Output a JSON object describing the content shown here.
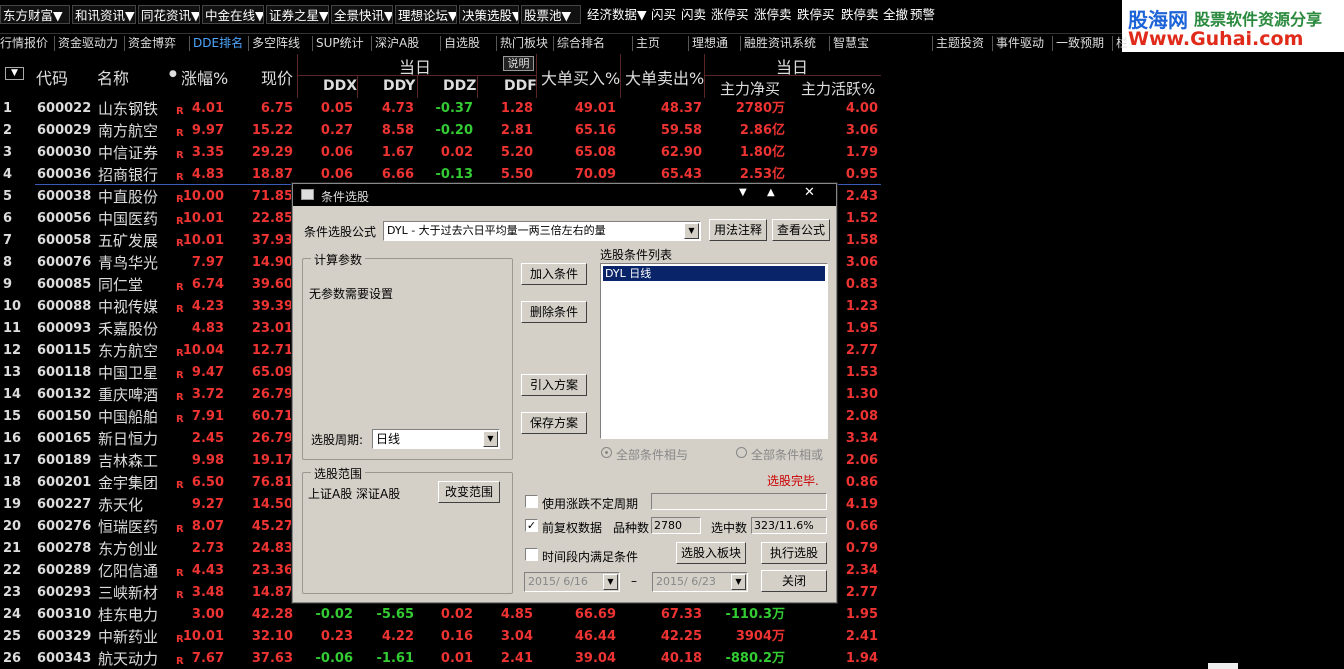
{
  "menu": [
    "东方财富▼",
    "和讯资讯▼",
    "同花资讯▼",
    "中金在线▼",
    "证券之星▼",
    "全景快讯▼",
    "理想论坛▼",
    "决策选股▼",
    "股票池▼"
  ],
  "menu_right": [
    "经济数据▼",
    "闪买",
    "闪卖",
    "涨停买",
    "涨停卖",
    "跌停买",
    "跌停卖",
    "全撤",
    "预警"
  ],
  "brand": {
    "line1": "股海网",
    "line1b": "股票软件资源分享",
    "line2": "Www.Guhai.com"
  },
  "tabs": [
    "行情报价",
    "资金驱动力",
    "资金博弈",
    "DDE排名",
    "多空阵线",
    "SUP统计",
    "深沪A股",
    "自选股",
    "热门板块",
    "综合排名",
    "主页",
    "理想通",
    "融胜资讯系统",
    "智慧宝",
    "主题投资",
    "事件驱动",
    "一致预期",
    "栏"
  ],
  "active_tab": "DDE排名",
  "table": {
    "headers": {
      "code": "代码",
      "name": "名称",
      "chg": "涨幅%",
      "price": "现价",
      "group1": "当日",
      "explain": "说明",
      "ddx": "DDX",
      "ddy": "DDY",
      "ddz": "DDZ",
      "ddf": "DDF",
      "buy": "大单买入%",
      "sell": "大单卖出%",
      "group2": "当日",
      "net": "主力净买",
      "act": "主力活跃%"
    },
    "rows": [
      {
        "n": "1",
        "code": "600022",
        "name": "山东钢铁",
        "r": "R",
        "chg": "4.01",
        "price": "6.75",
        "ddx": "0.05",
        "ddy": "4.73",
        "ddz": "-0.37",
        "ddf": "1.28",
        "buy": "49.01",
        "sell": "48.37",
        "net": "2780万",
        "act": "4.00"
      },
      {
        "n": "2",
        "code": "600029",
        "name": "南方航空",
        "r": "R",
        "chg": "9.97",
        "price": "15.22",
        "ddx": "0.27",
        "ddy": "8.58",
        "ddz": "-0.20",
        "ddf": "2.81",
        "buy": "65.16",
        "sell": "59.58",
        "net": "2.86亿",
        "act": "3.06"
      },
      {
        "n": "3",
        "code": "600030",
        "name": "中信证券",
        "r": "R",
        "chg": "3.35",
        "price": "29.29",
        "ddx": "0.06",
        "ddy": "1.67",
        "ddz": "0.02",
        "ddf": "5.20",
        "buy": "65.08",
        "sell": "62.90",
        "net": "1.80亿",
        "act": "1.79"
      },
      {
        "n": "4",
        "code": "600036",
        "name": "招商银行",
        "r": "R",
        "chg": "4.83",
        "price": "18.87",
        "ddx": "0.06",
        "ddy": "6.66",
        "ddz": "-0.13",
        "ddf": "5.50",
        "buy": "70.09",
        "sell": "65.43",
        "net": "2.53亿",
        "act": "0.95"
      },
      {
        "n": "5",
        "code": "600038",
        "name": "中直股份",
        "r": "R",
        "chg": "10.00",
        "price": "71.85",
        "ddx": "",
        "ddy": "",
        "ddz": "",
        "ddf": "",
        "buy": "",
        "sell": "",
        "net": "",
        "act": "2.43"
      },
      {
        "n": "6",
        "code": "600056",
        "name": "中国医药",
        "r": "R",
        "chg": "10.01",
        "price": "22.85",
        "ddx": "",
        "ddy": "",
        "ddz": "",
        "ddf": "",
        "buy": "",
        "sell": "",
        "net": "",
        "act": "1.52"
      },
      {
        "n": "7",
        "code": "600058",
        "name": "五矿发展",
        "r": "R",
        "chg": "10.01",
        "price": "37.93",
        "ddx": "",
        "ddy": "",
        "ddz": "",
        "ddf": "",
        "buy": "",
        "sell": "",
        "net": "",
        "act": "1.58"
      },
      {
        "n": "8",
        "code": "600076",
        "name": "青鸟华光",
        "r": "",
        "chg": "7.97",
        "price": "14.90",
        "ddx": "",
        "ddy": "",
        "ddz": "",
        "ddf": "",
        "buy": "",
        "sell": "",
        "net": "",
        "act": "3.06"
      },
      {
        "n": "9",
        "code": "600085",
        "name": "同仁堂",
        "r": "R",
        "chg": "6.74",
        "price": "39.60",
        "ddx": "",
        "ddy": "",
        "ddz": "",
        "ddf": "",
        "buy": "",
        "sell": "",
        "net": "",
        "act": "0.83"
      },
      {
        "n": "10",
        "code": "600088",
        "name": "中视传媒",
        "r": "R",
        "chg": "4.23",
        "price": "39.39",
        "ddx": "",
        "ddy": "",
        "ddz": "",
        "ddf": "",
        "buy": "",
        "sell": "",
        "net": "",
        "act": "1.23"
      },
      {
        "n": "11",
        "code": "600093",
        "name": "禾嘉股份",
        "r": "",
        "chg": "4.83",
        "price": "23.01",
        "ddx": "",
        "ddy": "",
        "ddz": "",
        "ddf": "",
        "buy": "",
        "sell": "",
        "net": "",
        "act": "1.95"
      },
      {
        "n": "12",
        "code": "600115",
        "name": "东方航空",
        "r": "R",
        "chg": "10.04",
        "price": "12.71",
        "ddx": "",
        "ddy": "",
        "ddz": "",
        "ddf": "",
        "buy": "",
        "sell": "",
        "net": "",
        "act": "2.77"
      },
      {
        "n": "13",
        "code": "600118",
        "name": "中国卫星",
        "r": "R",
        "chg": "9.47",
        "price": "65.09",
        "ddx": "",
        "ddy": "",
        "ddz": "",
        "ddf": "",
        "buy": "",
        "sell": "",
        "net": "",
        "act": "1.53"
      },
      {
        "n": "14",
        "code": "600132",
        "name": "重庆啤酒",
        "r": "R",
        "chg": "3.72",
        "price": "26.79",
        "ddx": "",
        "ddy": "",
        "ddz": "",
        "ddf": "",
        "buy": "",
        "sell": "",
        "net": "",
        "act": "1.30"
      },
      {
        "n": "15",
        "code": "600150",
        "name": "中国船舶",
        "r": "R",
        "chg": "7.91",
        "price": "60.71",
        "ddx": "",
        "ddy": "",
        "ddz": "",
        "ddf": "",
        "buy": "",
        "sell": "",
        "net": "",
        "act": "2.08"
      },
      {
        "n": "16",
        "code": "600165",
        "name": "新日恒力",
        "r": "",
        "chg": "2.45",
        "price": "26.79",
        "ddx": "",
        "ddy": "",
        "ddz": "",
        "ddf": "",
        "buy": "",
        "sell": "",
        "net": "",
        "act": "3.34"
      },
      {
        "n": "17",
        "code": "600189",
        "name": "吉林森工",
        "r": "",
        "chg": "9.98",
        "price": "19.17",
        "ddx": "",
        "ddy": "",
        "ddz": "",
        "ddf": "",
        "buy": "",
        "sell": "",
        "net": "",
        "act": "2.06"
      },
      {
        "n": "18",
        "code": "600201",
        "name": "金宇集团",
        "r": "R",
        "chg": "6.50",
        "price": "76.81",
        "ddx": "",
        "ddy": "",
        "ddz": "",
        "ddf": "",
        "buy": "",
        "sell": "",
        "net": "",
        "act": "0.86"
      },
      {
        "n": "19",
        "code": "600227",
        "name": "赤天化",
        "r": "",
        "chg": "9.27",
        "price": "14.50",
        "ddx": "",
        "ddy": "",
        "ddz": "",
        "ddf": "",
        "buy": "",
        "sell": "",
        "net": "",
        "act": "4.19"
      },
      {
        "n": "20",
        "code": "600276",
        "name": "恒瑞医药",
        "r": "R",
        "chg": "8.07",
        "price": "45.27",
        "ddx": "",
        "ddy": "",
        "ddz": "",
        "ddf": "",
        "buy": "",
        "sell": "",
        "net": "",
        "act": "0.66"
      },
      {
        "n": "21",
        "code": "600278",
        "name": "东方创业",
        "r": "",
        "chg": "2.73",
        "price": "24.83",
        "ddx": "",
        "ddy": "",
        "ddz": "",
        "ddf": "",
        "buy": "",
        "sell": "",
        "net": "",
        "act": "0.79"
      },
      {
        "n": "22",
        "code": "600289",
        "name": "亿阳信通",
        "r": "R",
        "chg": "4.43",
        "price": "23.36",
        "ddx": "",
        "ddy": "",
        "ddz": "",
        "ddf": "",
        "buy": "",
        "sell": "",
        "net": "",
        "act": "2.34"
      },
      {
        "n": "23",
        "code": "600293",
        "name": "三峡新材",
        "r": "R",
        "chg": "3.48",
        "price": "14.87",
        "ddx": "",
        "ddy": "",
        "ddz": "",
        "ddf": "",
        "buy": "",
        "sell": "",
        "net": "",
        "act": "2.77"
      },
      {
        "n": "24",
        "code": "600310",
        "name": "桂东电力",
        "r": "",
        "chg": "3.00",
        "price": "42.28",
        "ddx": "-0.02",
        "ddy": "-5.65",
        "ddz": "0.02",
        "ddf": "4.85",
        "buy": "66.69",
        "sell": "67.33",
        "net": "-110.3万",
        "act": "1.95"
      },
      {
        "n": "25",
        "code": "600329",
        "name": "中新药业",
        "r": "R",
        "chg": "10.01",
        "price": "32.10",
        "ddx": "0.23",
        "ddy": "4.22",
        "ddz": "0.16",
        "ddf": "3.04",
        "buy": "46.44",
        "sell": "42.25",
        "net": "3904万",
        "act": "2.41"
      },
      {
        "n": "26",
        "code": "600343",
        "name": "航天动力",
        "r": "R",
        "chg": "7.67",
        "price": "37.63",
        "ddx": "-0.06",
        "ddy": "-1.61",
        "ddz": "0.01",
        "ddf": "2.41",
        "buy": "39.04",
        "sell": "40.18",
        "net": "-880.2万",
        "act": "1.94"
      }
    ]
  },
  "dialog": {
    "title": "条件选股",
    "formula_label": "条件选股公式",
    "formula_value": "DYL        - 大于过去六日平均量一两三倍左右的量",
    "usage_btn": "用法注释",
    "view_btn": "查看公式",
    "calc_group": "计算参数",
    "no_params": "无参数需要设置",
    "period_label": "选股周期:",
    "period_value": "日线",
    "add_btn": "加入条件",
    "del_btn": "删除条件",
    "import_btn": "引入方案",
    "save_btn": "保存方案",
    "list_label": "选股条件列表",
    "list_item": "DYL  日线",
    "radio_and": "全部条件相与",
    "radio_or": "全部条件相或",
    "status": "选股完毕.",
    "range_group": "选股范围",
    "range_value": "上证A股  深证A股",
    "range_btn": "改变范围",
    "use_period": "使用涨跌不定周期",
    "adjust": "前复权数据",
    "count_label": "品种数",
    "count_value": "2780",
    "hit_label": "选中数",
    "hit_value": "323/11.6%",
    "time_cond": "时间段内满足条件",
    "to_block_btn": "选股入板块",
    "run_btn": "执行选股",
    "date_from": "2015/ 6/16",
    "date_sep": "–",
    "date_to": "2015/ 6/23",
    "close_btn": "关闭"
  }
}
